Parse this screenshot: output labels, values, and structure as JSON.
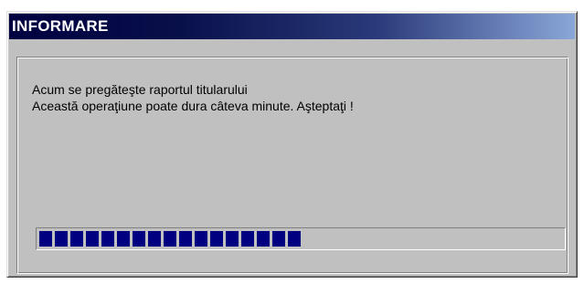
{
  "window": {
    "title": "INFORMARE"
  },
  "message": {
    "line1": "Acum se pregăteşte raportul titularului",
    "line2": "Această operaţiune poate dura câteva minute. Aşteptaţi !"
  },
  "progress": {
    "fraction": 0.52,
    "color": "#000080"
  },
  "colors": {
    "title_bar_start": "#000040",
    "title_bar_end": "#8aa6d8",
    "window_face": "#c0c0c0"
  }
}
